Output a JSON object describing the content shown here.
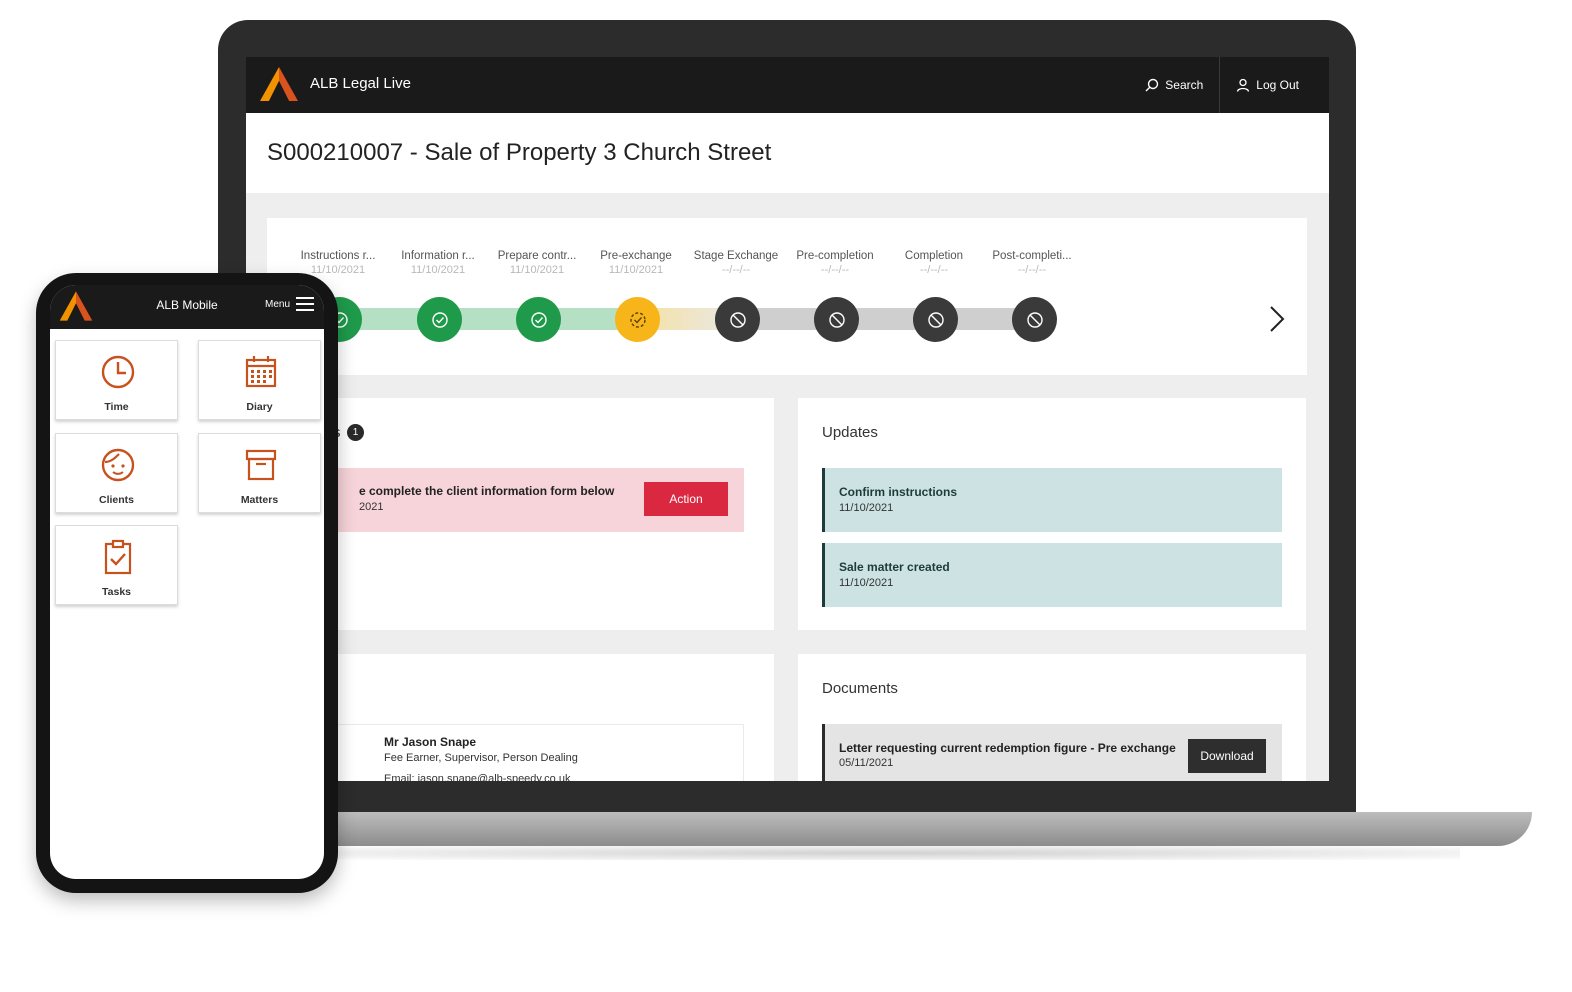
{
  "laptop": {
    "app_title": "ALB  Legal Live",
    "search_label": "Search",
    "logout_label": "Log Out",
    "page_title": "S000210007 - Sale of Property 3 Church Street",
    "stages": [
      {
        "name": "Instructions r...",
        "date": "11/10/2021",
        "status": "complete"
      },
      {
        "name": "Information r...",
        "date": "11/10/2021",
        "status": "complete"
      },
      {
        "name": "Prepare contr...",
        "date": "11/10/2021",
        "status": "complete"
      },
      {
        "name": "Pre-exchange",
        "date": "11/10/2021",
        "status": "in-progress"
      },
      {
        "name": "Stage Exchange",
        "date": "--/--/--",
        "status": "not-started"
      },
      {
        "name": "Pre-completion",
        "date": "--/--/--",
        "status": "not-started"
      },
      {
        "name": "Completion",
        "date": "--/--/--",
        "status": "not-started"
      },
      {
        "name": "Post-completi...",
        "date": "--/--/--",
        "status": "not-started"
      }
    ],
    "tasks": {
      "title_fragment": "s",
      "badge_count": "1",
      "item_text": "e complete the client information form below",
      "item_date": "2021",
      "action_label": "Action"
    },
    "updates": {
      "title": "Updates",
      "items": [
        {
          "name": "Confirm instructions",
          "date": "11/10/2021"
        },
        {
          "name": "Sale matter created",
          "date": "11/10/2021"
        }
      ]
    },
    "contact": {
      "name": "Mr Jason Snape",
      "role": "Fee Earner, Supervisor, Person Dealing",
      "email": "Email: jason.snape@alb-speedy.co.uk"
    },
    "documents": {
      "title": "Documents",
      "items": [
        {
          "name": "Letter requesting current redemption figure - Pre exchange",
          "date": "05/11/2021",
          "button": "Download"
        }
      ]
    }
  },
  "phone": {
    "title": "ALB Mobile",
    "menu_label": "Menu",
    "tiles": [
      {
        "label": "Time",
        "icon": "clock-icon"
      },
      {
        "label": "Diary",
        "icon": "calendar-icon"
      },
      {
        "label": "Clients",
        "icon": "client-face-icon"
      },
      {
        "label": "Matters",
        "icon": "archive-box-icon"
      },
      {
        "label": "Tasks",
        "icon": "clipboard-check-icon"
      }
    ]
  },
  "colors": {
    "brand_orange": "#f39200",
    "complete_green": "#1f9a4b",
    "in_progress_yellow": "#f7b51a",
    "not_started_grey": "#3a3a3a",
    "action_red": "#d9283f",
    "update_teal": "#cde3e3",
    "tile_icon": "#c8521e"
  }
}
